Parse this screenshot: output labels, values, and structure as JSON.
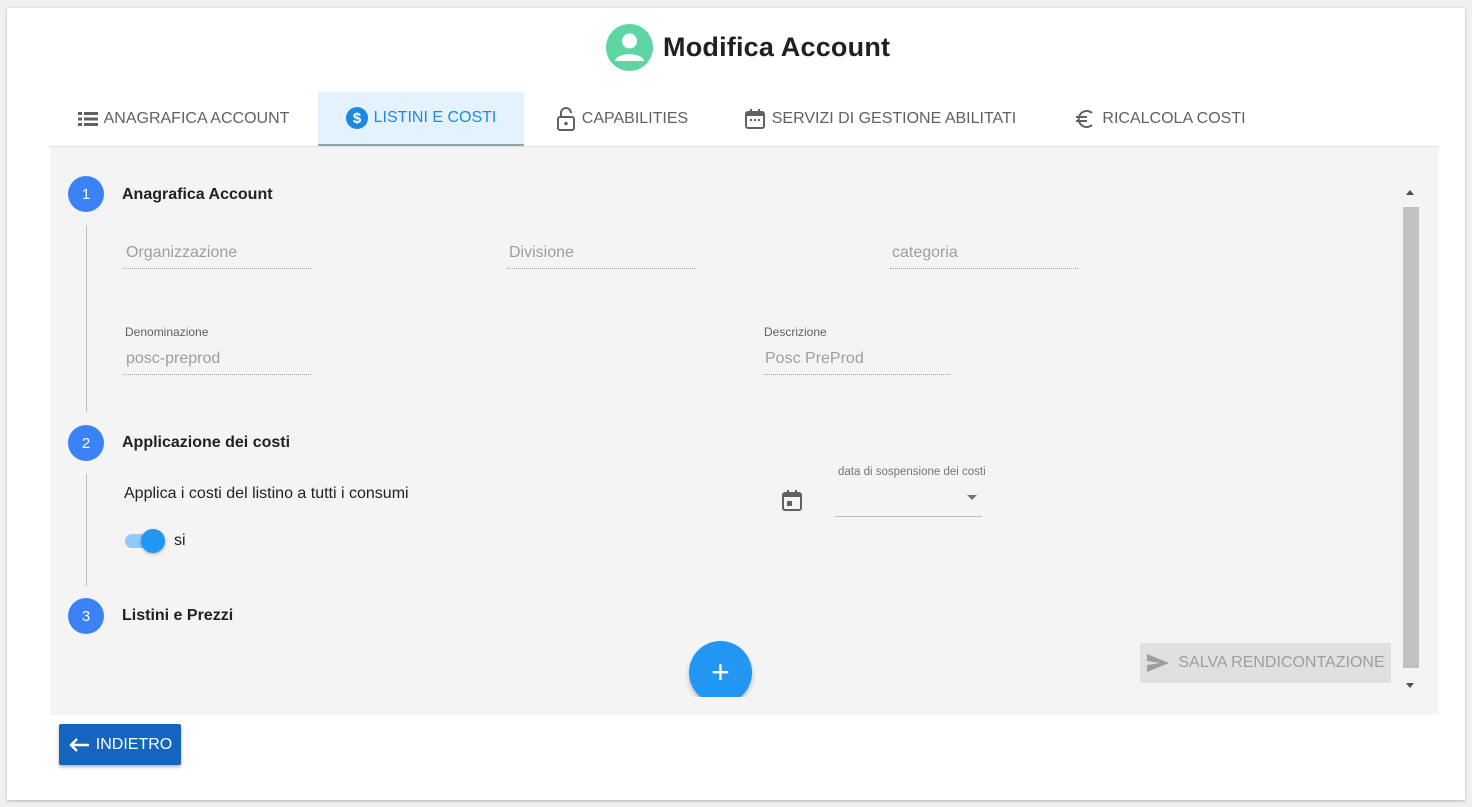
{
  "header": {
    "title": "Modifica Account"
  },
  "tabs": [
    {
      "label": "ANAGRAFICA ACCOUNT",
      "icon": "list-icon"
    },
    {
      "label": "LISTINI E COSTI",
      "icon": "dollar-icon",
      "active": true
    },
    {
      "label": "CAPABILITIES",
      "icon": "lock-open-icon"
    },
    {
      "label": "SERVIZI DI GESTIONE ABILITATI",
      "icon": "calendar-icon"
    },
    {
      "label": "RICALCOLA COSTI",
      "icon": "euro-icon"
    }
  ],
  "steps": [
    {
      "number": "1",
      "title": "Anagrafica Account"
    },
    {
      "number": "2",
      "title": "Applicazione dei costi"
    },
    {
      "number": "3",
      "title": "Listini e Prezzi"
    }
  ],
  "step1": {
    "organizzazione_placeholder": "Organizzazione",
    "divisione_placeholder": "Divisione",
    "categoria_placeholder": "categoria",
    "denominazione_label": "Denominazione",
    "denominazione_value": "posc-preprod",
    "descrizione_label": "Descrizione",
    "descrizione_value": "Posc PreProd"
  },
  "step2": {
    "applica_text": "Applica i costi del listino a tutti i consumi",
    "toggle_label": "si",
    "toggle_on": true,
    "data_sospensione_label": "data di sospensione dei costi",
    "data_sospensione_value": ""
  },
  "buttons": {
    "add": "+",
    "salva": "SALVA RENDICONTAZIONE",
    "indietro": "INDIETRO"
  },
  "colors": {
    "primary": "#2196f3",
    "step": "#3b82f6",
    "avatar": "#5fd6a2",
    "back_button": "#1565c0",
    "tab_active_bg": "#e3f2fd"
  }
}
